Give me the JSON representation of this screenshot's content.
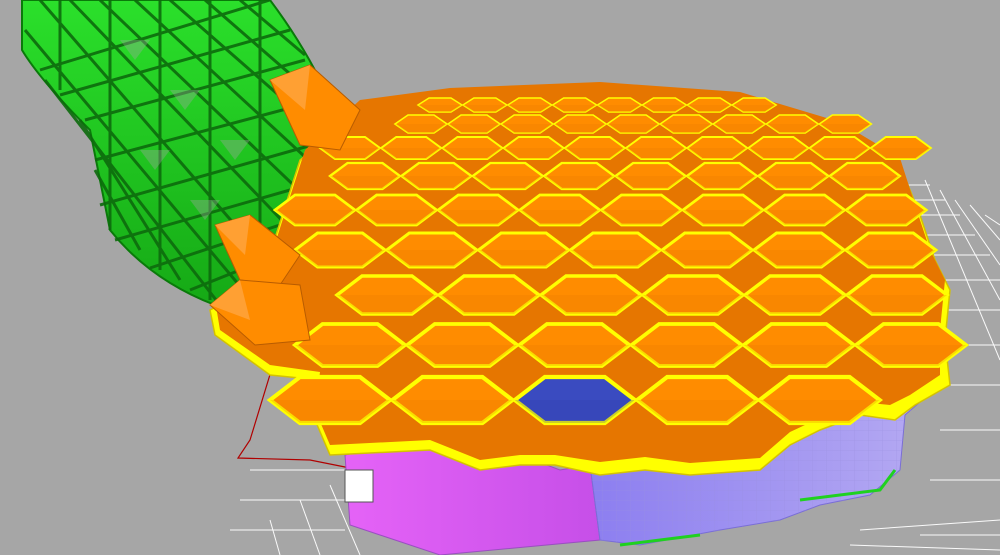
{
  "viewport": {
    "background": "#a6a6a6",
    "grid_color": "#ffffff",
    "outline_color": "#b00000"
  },
  "model": {
    "hex_panel_color": "#ff8c00",
    "hex_panel_dark": "#e67600",
    "hex_border_color": "#ffff00",
    "selected_panel_color": "#3a4bc0",
    "lattice_color": "#1fd11f",
    "lattice_dark": "#0a7a0a",
    "side_magenta": "#e05cf5",
    "side_lavender": "#a999ee",
    "side_blue": "#7f6fe8"
  },
  "selection": {
    "selected_panel": "blue-hexagon",
    "count": 1
  }
}
